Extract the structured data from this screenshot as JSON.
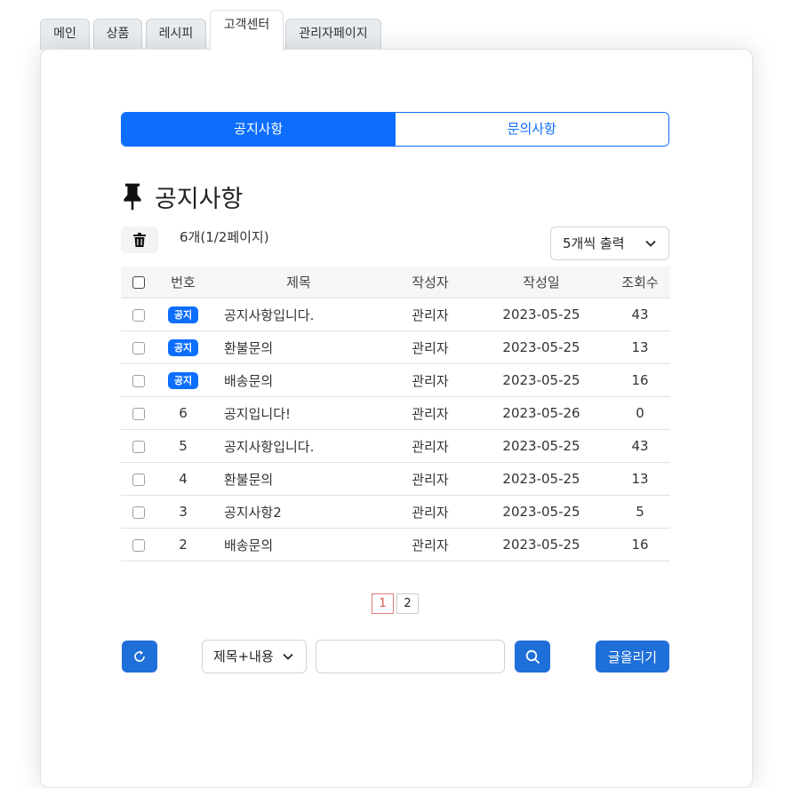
{
  "top_tabs": [
    "메인",
    "상품",
    "레시피",
    "고객센터",
    "관리자페이지"
  ],
  "active_top_tab": "고객센터",
  "segment": {
    "notice": "공지사항",
    "inquiry": "문의사항"
  },
  "page_title": "공지사항",
  "count_text": "6개(1/2페이지)",
  "per_page": "5개씩 출력",
  "columns": [
    "번호",
    "제목",
    "작성자",
    "작성일",
    "조회수"
  ],
  "rows": [
    {
      "no": "공지",
      "notice": true,
      "title": "공지사항입니다.",
      "author": "관리자",
      "date": "2023-05-25",
      "views": "43"
    },
    {
      "no": "공지",
      "notice": true,
      "title": "환불문의",
      "author": "관리자",
      "date": "2023-05-25",
      "views": "13"
    },
    {
      "no": "공지",
      "notice": true,
      "title": "배송문의",
      "author": "관리자",
      "date": "2023-05-25",
      "views": "16"
    },
    {
      "no": "6",
      "notice": false,
      "title": "공지입니다!",
      "author": "관리자",
      "date": "2023-05-26",
      "views": "0"
    },
    {
      "no": "5",
      "notice": false,
      "title": "공지사항입니다.",
      "author": "관리자",
      "date": "2023-05-25",
      "views": "43"
    },
    {
      "no": "4",
      "notice": false,
      "title": "환불문의",
      "author": "관리자",
      "date": "2023-05-25",
      "views": "13"
    },
    {
      "no": "3",
      "notice": false,
      "title": "공지사항2",
      "author": "관리자",
      "date": "2023-05-25",
      "views": "5"
    },
    {
      "no": "2",
      "notice": false,
      "title": "배송문의",
      "author": "관리자",
      "date": "2023-05-25",
      "views": "16"
    }
  ],
  "pagination": {
    "pages": [
      "1",
      "2"
    ],
    "current": "1"
  },
  "search": {
    "type": "제목+내용",
    "value": "",
    "placeholder": ""
  },
  "write_button": "글올리기",
  "icons": {
    "pin": "pushpin-icon",
    "delete": "trash-icon",
    "refresh": "refresh-icon",
    "search": "search-icon",
    "dropdown": "chevron-down-icon"
  },
  "colors": {
    "primary": "#0d6efd",
    "button": "#1f6fd8",
    "active_page": "#d9534f"
  }
}
